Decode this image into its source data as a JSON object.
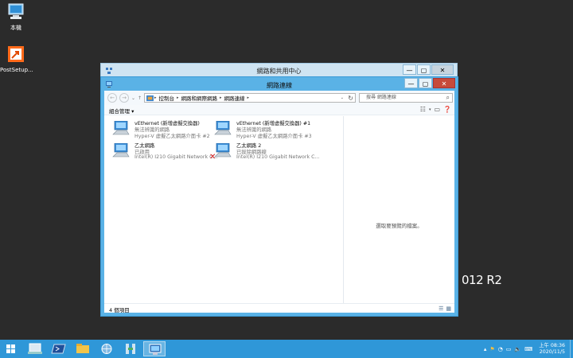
{
  "desktop": {
    "icons": [
      {
        "label": "本機",
        "icon": "computer-icon"
      },
      {
        "label": "PostSetup...",
        "icon": "shortcut-icon"
      }
    ],
    "watermark": "012 R2"
  },
  "back_window": {
    "title": "網路和共用中心",
    "controls": {
      "minimize": "—",
      "maximize": "▢",
      "close": "✕"
    }
  },
  "window": {
    "title": "網路連線",
    "controls": {
      "minimize": "—",
      "maximize": "▢",
      "close": "✕"
    },
    "nav": {
      "back": "←",
      "forward": "→",
      "recent": "⌄",
      "up": "↑"
    },
    "address": {
      "crumbs": [
        "控制台",
        "網路和網際網路",
        "網路連線"
      ],
      "separator": "▸"
    },
    "search": {
      "placeholder": "搜尋 網路連線"
    },
    "organize_label": "組合管理 ▾",
    "adapters": [
      {
        "name": "vEthernet (新增虛擬交換器)",
        "status": "無法辨識的網路",
        "device": "Hyper-V 虛擬乙太網路介面卡 #2",
        "disabled": false
      },
      {
        "name": "vEthernet (新增虛擬交換器) #1",
        "status": "無法辨識的網路",
        "device": "Hyper-V 虛擬乙太網路介面卡 #3",
        "disabled": false
      },
      {
        "name": "乙太網路",
        "status": "已啟用",
        "device": "Intel(R) I210 Gigabit Network C...",
        "disabled": false
      },
      {
        "name": "乙太網路 2",
        "status": "已拔除網路線",
        "device": "Intel(R) I210 Gigabit Network C...",
        "disabled": true
      }
    ],
    "preview_message": "選取要預覽的檔案。",
    "status_count": "4 個項目"
  },
  "taskbar": {
    "apps": [
      "windows-start-icon",
      "server-manager-icon",
      "powershell-icon",
      "file-explorer-icon",
      "network-center-icon",
      "hyper-v-icon",
      "remote-desktop-icon"
    ],
    "clock": {
      "time": "上午 08:36",
      "date": "2020/11/5"
    }
  },
  "colors": {
    "accent": "#5ab2e6",
    "taskbar": "#2f97d8",
    "close": "#c74a3a"
  }
}
